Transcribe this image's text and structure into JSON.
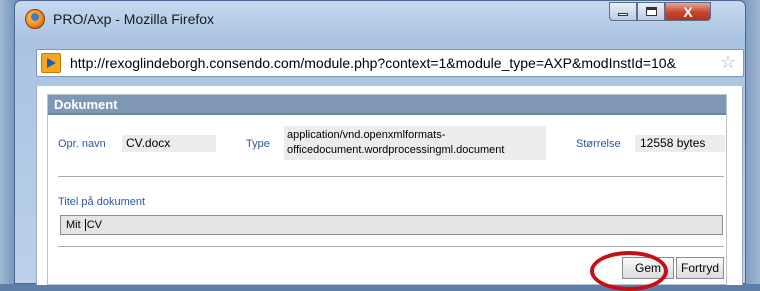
{
  "window": {
    "title": "PRO/Axp - Mozilla Firefox",
    "icons": {
      "app": "firefox-icon",
      "minimize": "minimize-icon",
      "maximize": "maximize-icon",
      "close": "close-icon"
    },
    "close_glyph": "X"
  },
  "addressbar": {
    "url": "http://rexoglindeborgh.consendo.com/module.php?context=1&module_type=AXP&modInstId=10&",
    "site_icon": "site-favicon-icon",
    "bookmark_icon": "star-icon",
    "star_glyph": "☆"
  },
  "dialog": {
    "header": "Dokument",
    "fields": {
      "orig_name_label": "Opr. navn",
      "orig_name_value": "CV.docx",
      "type_label": "Type",
      "type_value_line1": "application/vnd.openxmlformats-",
      "type_value_line2": "officedocument.wordprocessingml.document",
      "size_label": "Størrelse",
      "size_value": "12558 bytes"
    },
    "title_label": "Titel på dokument",
    "title_value_before_caret": "Mit ",
    "title_value_after_caret": "CV",
    "buttons": {
      "save": "Gem",
      "cancel": "Fortryd"
    }
  },
  "colors": {
    "header_bg": "#7f98b5",
    "label_blue": "#2a57a6",
    "highlight_ring": "#c40f17",
    "close_red": "#c6452d"
  }
}
